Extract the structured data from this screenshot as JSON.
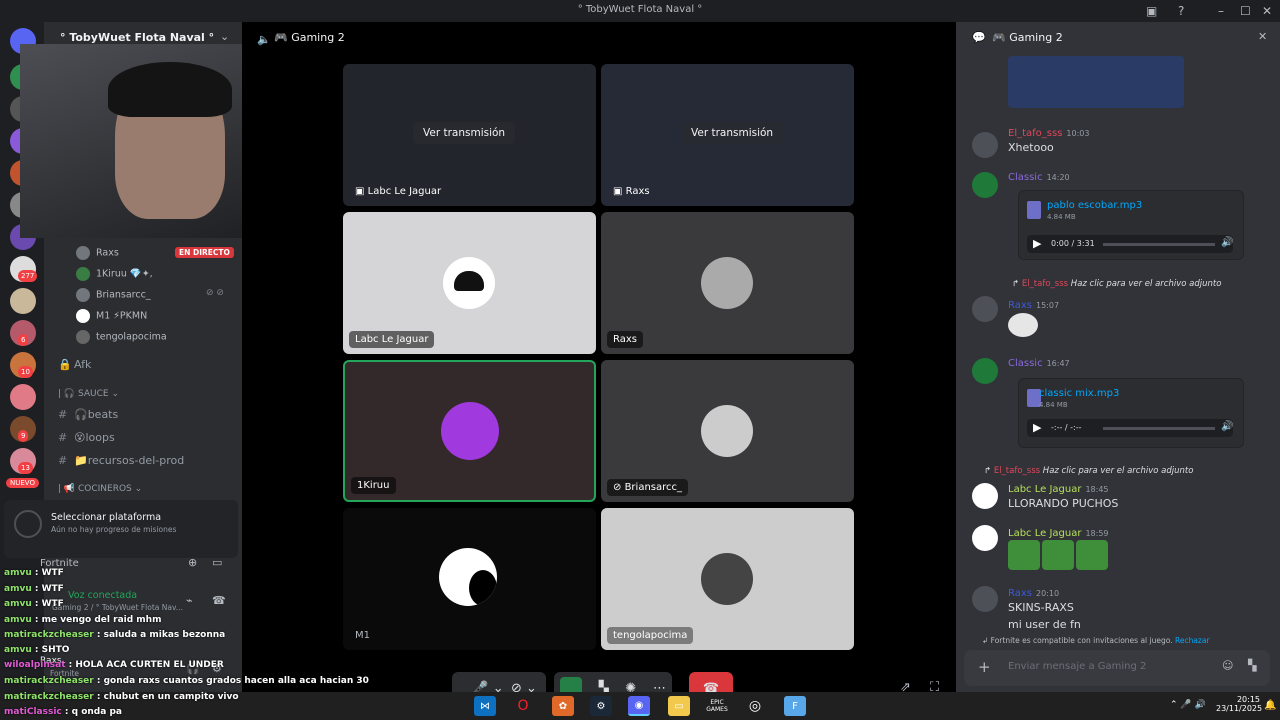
{
  "window": {
    "title": "° TobyWuet Flota Naval °"
  },
  "server": {
    "name": "° TobyWuet Flota Naval °",
    "voice_channel": "Gaming 2"
  },
  "guild_badges": {
    "b1": "277",
    "b2": "6",
    "b3": "10",
    "b4": "9",
    "b5": "13",
    "new": "NUEVO"
  },
  "sidebar": {
    "voice_users": [
      {
        "name": "Raxs",
        "badge": "EN DIRECTO"
      },
      {
        "name": "1Kiruu 💎✦,"
      },
      {
        "name": "Briansarcc_"
      },
      {
        "name": "M1 ⚡PKMN"
      },
      {
        "name": "tengolapocima"
      }
    ],
    "afk": "Afk",
    "category_sauce": "SAUCE",
    "channels": [
      "🎧beats",
      "😵loops",
      "📁recursos-del-prod"
    ],
    "category_cocineros": "COCINEROS",
    "quest_title": "Seleccionar plataforma",
    "quest_sub": "Aún no hay progreso de misiones",
    "game": "Fortnite",
    "voice_status": "Voz conectada",
    "voice_sub": "Gaming 2 / ° TobyWuet Flota Nav...",
    "user_name": "Raxs",
    "user_status": "Fortnite"
  },
  "stage": {
    "streams": [
      {
        "label": "Labc Le Jaguar",
        "action": "Ver transmisión"
      },
      {
        "label": "Raxs",
        "action": "Ver transmisión"
      }
    ],
    "tiles": [
      "Labc Le Jaguar",
      "Raxs",
      "1Kiruu",
      "Briansarcc_",
      "M1",
      "tengolapocima"
    ]
  },
  "chat": {
    "channel": "Gaming 2",
    "messages": [
      {
        "user": "El_tafo_sss",
        "time": "10:03",
        "text": "Xhetooo",
        "color": "#e2475a"
      },
      {
        "user": "Classic",
        "time": "14:20",
        "file": "pablo escobar.mp3",
        "size": "4.84 MB",
        "player": "0:00 / 3:31",
        "color": "#8a6bd9"
      },
      {
        "reply_user": "El_tafo_sss",
        "reply": "Haz clic para ver el archivo adjunto",
        "user": "Raxs",
        "time": "15:07",
        "color": "#3b5bd9"
      },
      {
        "user": "Classic",
        "time": "16:47",
        "file": "classic mix.mp3",
        "size": "4.84 MB",
        "player": "-:-- / -:--",
        "color": "#8a6bd9"
      },
      {
        "reply_user": "El_tafo_sss",
        "reply": "Haz clic para ver el archivo adjunto",
        "user": "Labc Le Jaguar",
        "time": "18:45",
        "text": "LLORANDO PUCHOS",
        "color": "#b6e05a"
      },
      {
        "user": "Labc Le Jaguar",
        "time": "18:59",
        "color": "#b6e05a"
      },
      {
        "user": "Raxs",
        "time": "20:10",
        "text": "SKINS-RAXS",
        "text2": "mi user de fn",
        "color": "#3b5bd9"
      }
    ],
    "invite_note": "Fortnite es compatible con invitaciones al juego.",
    "invite_action": "Rechazar",
    "input_placeholder": "Enviar mensaje a  Gaming 2"
  },
  "twitch_chat": [
    {
      "user": "amvu",
      "text": ": WTF"
    },
    {
      "user": "amvu",
      "text": ": WTF"
    },
    {
      "user": "amvu",
      "text": ": WTF"
    },
    {
      "user": "amvu",
      "text": ": me vengo del raid mhm"
    },
    {
      "user": "matirackzcheaser",
      "text": ": saluda a mikas bezonna"
    },
    {
      "user": "amvu",
      "text": ": SHTO"
    },
    {
      "user": "wiloalpinsat",
      "text": ": HOLA ACA CURTEN EL UNDER"
    },
    {
      "user": "matirackzcheaser",
      "text": ": gonda raxs cuantos grados hacen alla aca hacian 30"
    },
    {
      "user": "matirackzcheaser",
      "text": ": chubut en un campito vivo"
    },
    {
      "user": "matiClassic",
      "text": ": q onda pa"
    }
  ],
  "taskbar": {
    "time": "20:15",
    "date": "23/11/2025",
    "epic": "EPIC GAMES"
  }
}
